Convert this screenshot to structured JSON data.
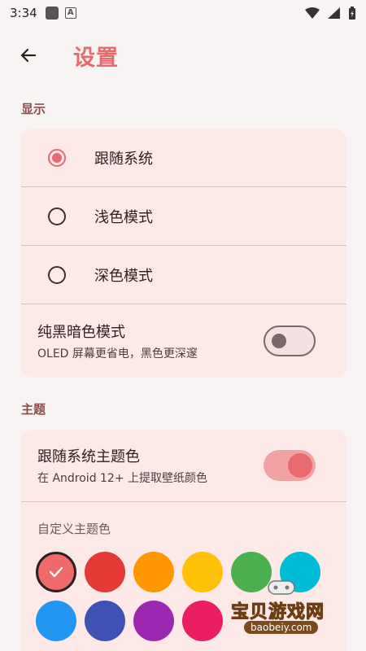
{
  "status": {
    "time": "3:34",
    "a_glyph": "A"
  },
  "header": {
    "title": "设置"
  },
  "display": {
    "section_label": "显示",
    "options": [
      {
        "label": "跟随系统",
        "selected": true
      },
      {
        "label": "浅色模式",
        "selected": false
      },
      {
        "label": "深色模式",
        "selected": false
      }
    ],
    "pure_black": {
      "title": "纯黑暗色模式",
      "subtitle": "OLED 屏幕更省电，黑色更深邃",
      "enabled": false
    }
  },
  "theme": {
    "section_label": "主题",
    "follow_system": {
      "title": "跟随系统主题色",
      "subtitle": "在 Android 12+ 上提取壁纸颜色",
      "enabled": true
    },
    "custom_label": "自定义主题色",
    "swatches": [
      "#f06a6a",
      "#e53935",
      "#ff9800",
      "#ffc107",
      "#4caf50",
      "#00bcd4",
      "#2196f3",
      "#3f51b5",
      "#9c27b0",
      "#e91e63"
    ],
    "selected_index": 0
  },
  "watermark": {
    "text": "宝贝游戏网",
    "url": "baobeiy.com"
  },
  "colors": {
    "accent": "#e8696e",
    "card": "#fde9e8",
    "background": "#f8f4f3"
  }
}
